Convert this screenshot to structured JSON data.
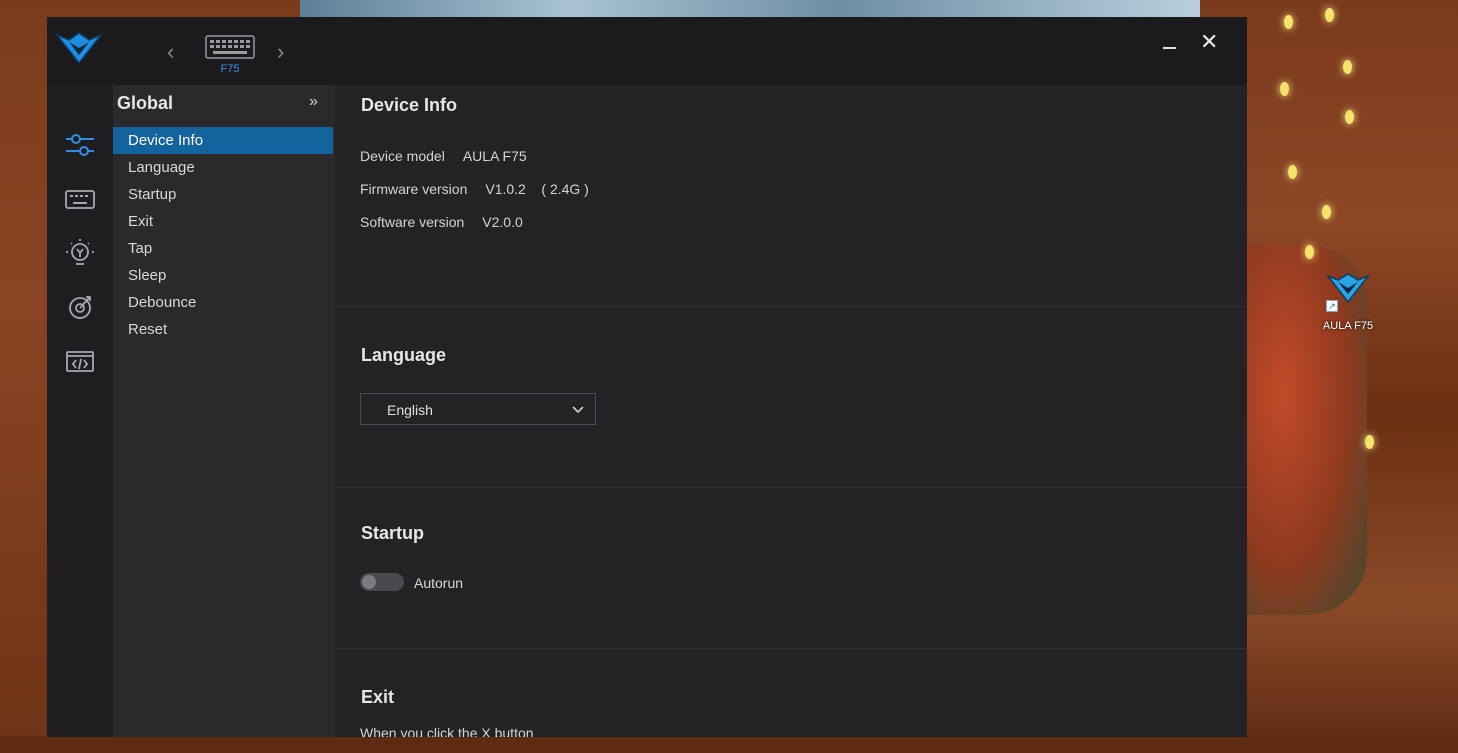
{
  "desktop": {
    "shortcut_label": "AULA F75"
  },
  "header": {
    "device_name": "F75",
    "minimize_icon": "minimize-icon",
    "close_symbol": "✕"
  },
  "sidebar_icons": [
    "sliders-icon",
    "keyboard-icon",
    "lightbulb-icon",
    "target-icon",
    "code-icon"
  ],
  "subnav": {
    "title": "Global",
    "expand_symbol": "»",
    "items": [
      {
        "label": "Device Info",
        "active": true
      },
      {
        "label": "Language"
      },
      {
        "label": "Startup"
      },
      {
        "label": "Exit"
      },
      {
        "label": "Tap"
      },
      {
        "label": "Sleep"
      },
      {
        "label": "Debounce"
      },
      {
        "label": "Reset"
      }
    ]
  },
  "device_info": {
    "title": "Device Info",
    "model_label": "Device model",
    "model_value": "AULA F75",
    "firmware_label": "Firmware version",
    "firmware_value": "V1.0.2    ( 2.4G )",
    "software_label": "Software version",
    "software_value": "V2.0.0"
  },
  "language": {
    "title": "Language",
    "selected": "English"
  },
  "startup": {
    "title": "Startup",
    "autorun_label": "Autorun",
    "autorun_on": false
  },
  "exit": {
    "title": "Exit",
    "description": "When you click the X button"
  },
  "colors": {
    "accent": "#12639e",
    "accent_text": "#2f8fe8",
    "window_bg": "#232326"
  }
}
